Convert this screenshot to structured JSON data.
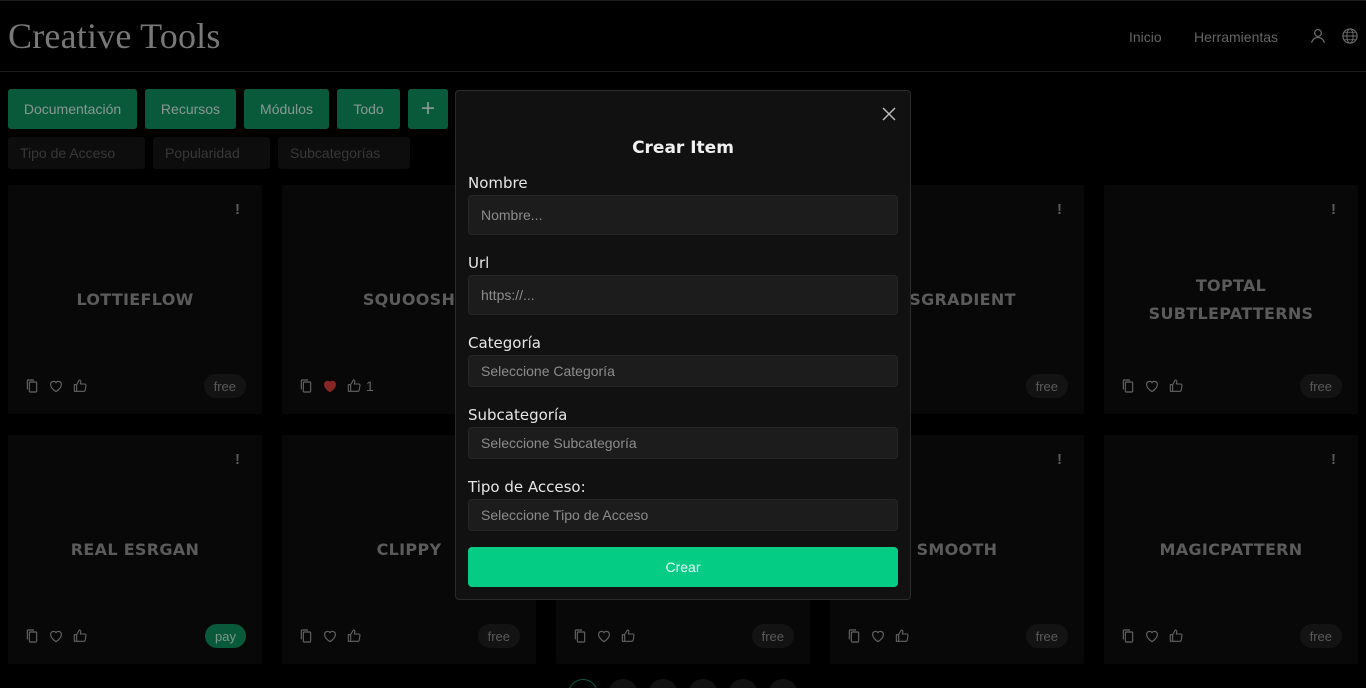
{
  "header": {
    "brand": "Creative Tools",
    "nav": {
      "inicio": "Inicio",
      "herramientas": "Herramientas"
    }
  },
  "toolbar": {
    "buttons": [
      "Documentación",
      "Recursos",
      "Módulos",
      "Todo"
    ],
    "add_symbol": "+"
  },
  "filters": [
    "Tipo de Acceso",
    "Popularidad",
    "Subcategorías"
  ],
  "cards": [
    {
      "title": "LOTTIEFLOW",
      "badge": "free",
      "liked": false,
      "likes": ""
    },
    {
      "title": "SQUOOSH",
      "badge": "",
      "liked": true,
      "likes": "1"
    },
    {
      "title": "",
      "badge": "",
      "liked": false,
      "likes": ""
    },
    {
      "title": "SSGRADIENT",
      "badge": "free",
      "liked": false,
      "likes": ""
    },
    {
      "title": "TOPTAL SUBTLEPATTERNS",
      "badge": "free",
      "liked": false,
      "likes": ""
    },
    {
      "title": "REAL ESRGAN",
      "badge": "pay",
      "liked": false,
      "likes": ""
    },
    {
      "title": "CLIPPY",
      "badge": "free",
      "liked": false,
      "likes": ""
    },
    {
      "title": "",
      "badge": "free",
      "liked": false,
      "likes": ""
    },
    {
      "title": "SMOOTH",
      "badge": "free",
      "liked": false,
      "likes": ""
    },
    {
      "title": "MAGICPATTERN",
      "badge": "free",
      "liked": false,
      "likes": ""
    }
  ],
  "card_bang": "!",
  "modal": {
    "title": "Crear Item",
    "nombre_label": "Nombre",
    "nombre_placeholder": "Nombre...",
    "url_label": "Url",
    "url_placeholder": "https://...",
    "categoria_label": "Categoría",
    "categoria_value": "Seleccione Categoría",
    "subcategoria_label": "Subcategoría",
    "subcategoria_value": "Seleccione Subcategoría",
    "acceso_label": "Tipo de Acceso:",
    "acceso_value": "Seleccione Tipo de Acceso",
    "submit_label": "Crear"
  },
  "colors": {
    "accent": "#05cc85",
    "button_green": "#0f8a5a",
    "liked": "#d13a3a"
  },
  "icons": {
    "user": "user-icon",
    "globe": "globe-icon",
    "close": "close-icon",
    "copy": "copy-icon",
    "heart": "heart-icon",
    "thumb": "thumbs-up-icon"
  }
}
